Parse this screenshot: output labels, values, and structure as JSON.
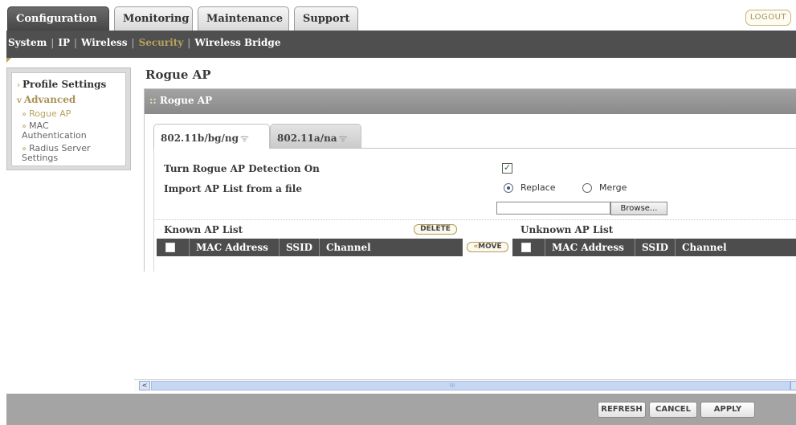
{
  "top_tabs": [
    {
      "label": "Configuration",
      "active": true
    },
    {
      "label": "Monitoring",
      "active": false
    },
    {
      "label": "Maintenance",
      "active": false
    },
    {
      "label": "Support",
      "active": false
    }
  ],
  "logout_label": "LOGOUT",
  "subnav": {
    "items": [
      "System",
      "IP",
      "Wireless",
      "Security",
      "Wireless Bridge"
    ],
    "active": "Security",
    "separator": "|"
  },
  "sidebar": {
    "profile_settings": "Profile Settings",
    "advanced": "Advanced",
    "rogue_ap": "Rogue AP",
    "mac_auth_line1": "MAC",
    "mac_auth_line2": "Authentication",
    "radius_line1": "Radius Server",
    "radius_line2": "Settings",
    "arrow_right": "›",
    "arrow_down": "v",
    "bullet": "»"
  },
  "page_title": "Rogue AP",
  "panel": {
    "title": "Rogue AP",
    "dots": "::"
  },
  "band_tabs": [
    {
      "label": "802.11b/bg/ng",
      "active": true
    },
    {
      "label": "802.11a/na",
      "active": false
    }
  ],
  "wifi_glyph": "ᯤ",
  "form": {
    "detection_label": "Turn Rogue AP Detection On",
    "detection_checked": true,
    "checkmark": "✓",
    "import_label": "Import AP List from a file",
    "replace_label": "Replace",
    "merge_label": "Merge",
    "import_mode": "Replace",
    "file_value": "",
    "browse_label": "Browse..."
  },
  "known_list": {
    "title": "Known AP List",
    "delete_label": "DELETE",
    "columns": [
      "MAC Address",
      "SSID",
      "Channel"
    ]
  },
  "move_label": "MOVE",
  "move_arrow": "«",
  "unknown_list": {
    "title": "Unknown AP List",
    "columns": [
      "MAC Address",
      "SSID",
      "Channel"
    ]
  },
  "scrollbar": {
    "left_arrow": "<",
    "grip": "III"
  },
  "footer": {
    "refresh_label": "REFRESH",
    "cancel_label": "CANCEL",
    "apply_label": "APPLY"
  }
}
